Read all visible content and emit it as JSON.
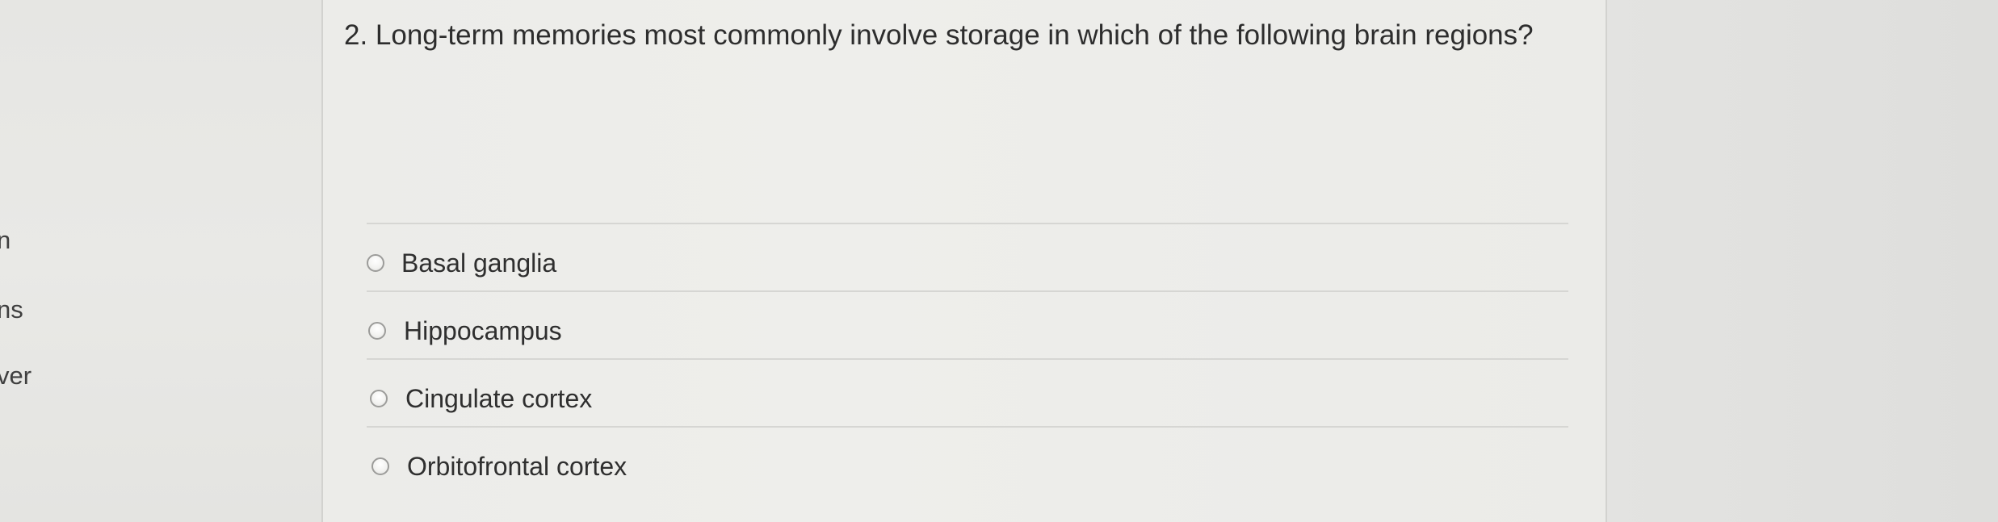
{
  "sidebar": {
    "fragments": [
      "n",
      "ns",
      "ver"
    ]
  },
  "question": {
    "text": "2. Long-term memories most commonly involve storage in which of the following brain regions?",
    "options": [
      {
        "label": "Basal ganglia"
      },
      {
        "label": "Hippocampus"
      },
      {
        "label": "Cingulate cortex"
      },
      {
        "label": "Orbitofrontal cortex"
      }
    ]
  }
}
